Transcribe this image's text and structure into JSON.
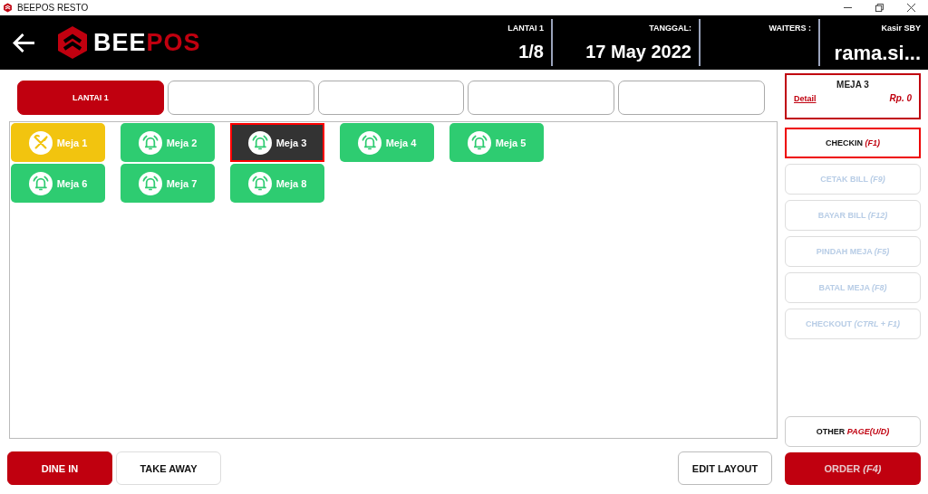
{
  "window": {
    "title": "BEEPOS RESTO"
  },
  "header": {
    "logo_left": "BEE",
    "logo_right": "POS",
    "floor_label": "LANTAI 1",
    "floor_value": "1/8",
    "date_label": "TANGGAL:",
    "date_value": "17 May 2022",
    "waiters_label": "WAITERS :",
    "cashier_label": "Kasir SBY",
    "cashier_value": "rama.si..."
  },
  "floor_tabs": [
    {
      "label": "LANTAI 1",
      "selected": true
    },
    {
      "selected": false
    },
    {
      "selected": false
    },
    {
      "selected": false
    },
    {
      "selected": false
    }
  ],
  "tables": [
    {
      "name": "Meja 1",
      "kind": "dining",
      "selected": false
    },
    {
      "name": "Meja 2",
      "kind": "free",
      "selected": false
    },
    {
      "name": "Meja 3",
      "kind": "free",
      "selected": true
    },
    {
      "name": "Meja 4",
      "kind": "free",
      "selected": false
    },
    {
      "name": "Meja 5",
      "kind": "free",
      "selected": false
    },
    {
      "name": "Meja 6",
      "kind": "free",
      "selected": false
    },
    {
      "name": "Meja 7",
      "kind": "free",
      "selected": false
    },
    {
      "name": "Meja 8",
      "kind": "free",
      "selected": false
    }
  ],
  "order_card": {
    "title": "MEJA 3",
    "link": "Detail",
    "amount": "Rp. 0"
  },
  "actions": [
    {
      "label": "CHECKIN",
      "key": "(F1)",
      "disabled": false,
      "selected": true
    },
    {
      "label": "CETAK BILL",
      "key": "(F9)",
      "disabled": true,
      "selected": false
    },
    {
      "label": "BAYAR BILL",
      "key": "(F12)",
      "disabled": true,
      "selected": false
    },
    {
      "label": "PINDAH MEJA",
      "key": "(F5)",
      "disabled": true,
      "selected": false
    },
    {
      "label": "BATAL MEJA",
      "key": "(F8)",
      "disabled": true,
      "selected": false
    },
    {
      "label": "CHECKOUT",
      "key": "(CTRL + F1)",
      "disabled": true,
      "selected": false
    }
  ],
  "other_page": {
    "label": "OTHER",
    "key": "PAGE(U/D)"
  },
  "modes": [
    {
      "label": "DINE IN",
      "selected": true
    },
    {
      "label": "TAKE AWAY",
      "selected": false
    }
  ],
  "edit_layout": "EDIT LAYOUT",
  "order": {
    "label": "ORDER",
    "key": "(F4)"
  }
}
